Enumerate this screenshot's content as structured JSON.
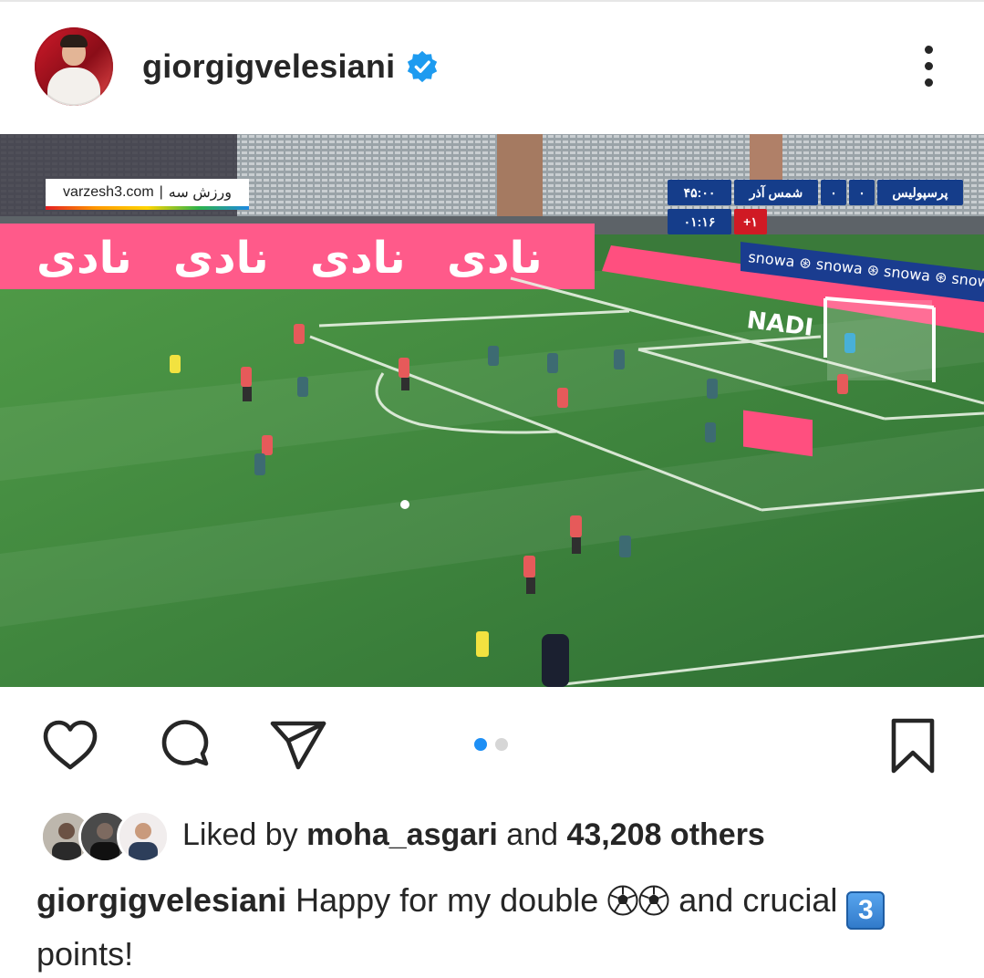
{
  "post": {
    "username": "giorgigvelesiani",
    "verified_icon": "verified-badge-icon",
    "more_icon": "more-vertical-icon"
  },
  "media": {
    "watermark_latin": "varzesh3.com",
    "watermark_sep": "|",
    "watermark_persian": "ورزش سه",
    "board_text": "نادی",
    "nadi_sign": "NADI",
    "snowa": "snowa",
    "scoreboard": {
      "team_home": "پرسپولیس",
      "score_home": "۰",
      "score_away": "۰",
      "team_away": "شمس آذر",
      "match_time": "۴۵:۰۰",
      "added_time": "۰۱:۱۶",
      "extra": "+۱"
    },
    "carousel": {
      "count": 2,
      "active": 1
    }
  },
  "actions": {
    "like_icon": "heart-icon",
    "comment_icon": "comment-icon",
    "share_icon": "send-icon",
    "save_icon": "bookmark-icon"
  },
  "likes": {
    "prefix": "Liked by ",
    "user": "moha_asgari",
    "middle": " and ",
    "count": "43,208 others"
  },
  "caption": {
    "username": "giorgigvelesiani",
    "text_1": " Happy for my double ",
    "text_2": " and crucial ",
    "keycap": "3",
    "text_3": "points!"
  },
  "colors": {
    "text": "#262626",
    "verified": "#1d9bf0",
    "carousel_active": "#1e8ff5",
    "carousel_inactive": "#d6d6d6",
    "pitch_green": "#3f8a3c",
    "board_pink": "#ff5a8a",
    "score_blue": "#153d8a"
  }
}
